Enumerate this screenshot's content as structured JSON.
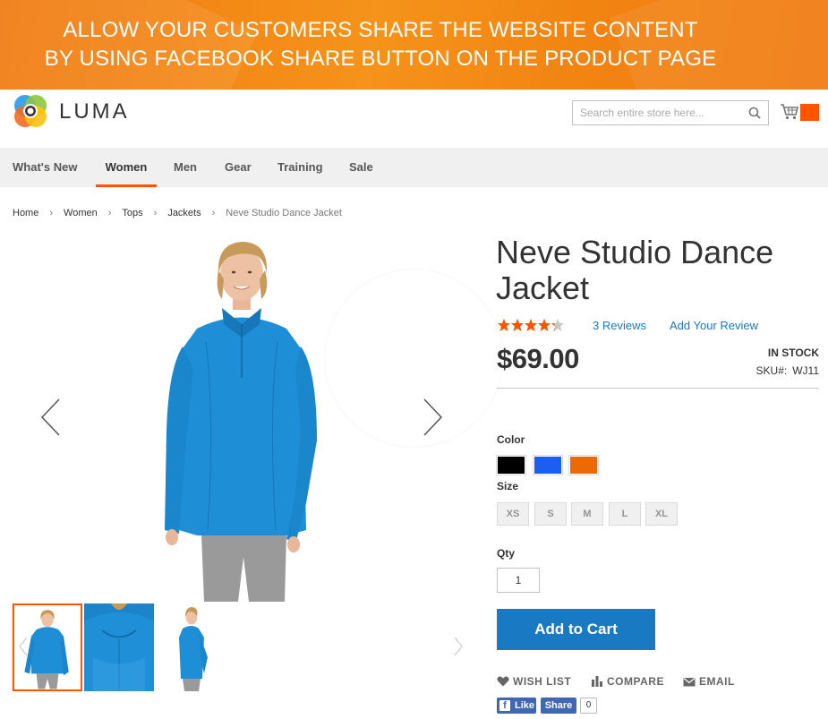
{
  "banner": {
    "line1": "ALLOW YOUR CUSTOMERS SHARE THE WEBSITE CONTENT",
    "line2": "BY USING FACEBOOK SHARE BUTTON ON THE PRODUCT PAGE"
  },
  "header": {
    "logo_text": "LUMA",
    "search_placeholder": "Search entire store here...",
    "search_icon": "search-icon",
    "cart_icon": "cart-icon"
  },
  "nav": {
    "items": [
      {
        "label": "What's New",
        "active": false
      },
      {
        "label": "Women",
        "active": true
      },
      {
        "label": "Men",
        "active": false
      },
      {
        "label": "Gear",
        "active": false
      },
      {
        "label": "Training",
        "active": false
      },
      {
        "label": "Sale",
        "active": false
      }
    ]
  },
  "breadcrumb": {
    "items": [
      "Home",
      "Women",
      "Tops",
      "Jackets"
    ],
    "current": "Neve Studio Dance Jacket"
  },
  "product": {
    "title": "Neve Studio Dance Jacket",
    "rating": 4.3,
    "rating_max": 5,
    "reviews_link": "3 Reviews",
    "add_review_link": "Add Your Review",
    "price": "$69.00",
    "stock": "IN STOCK",
    "sku_label": "SKU#:",
    "sku": "WJ11",
    "color_label": "Color",
    "colors": [
      "#000000",
      "#1a5ff0",
      "#ec6a06"
    ],
    "size_label": "Size",
    "sizes": [
      "XS",
      "S",
      "M",
      "L",
      "XL"
    ],
    "qty_label": "Qty",
    "qty": "1",
    "add_to_cart": "Add to Cart"
  },
  "actions": {
    "wishlist": "WISH LIST",
    "compare": "COMPARE",
    "email": "EMAIL"
  },
  "facebook": {
    "like": "Like",
    "share": "Share",
    "count": "0"
  },
  "colors": {
    "brand_orange": "#ff5501",
    "link_blue": "#1979c3",
    "fb_blue": "#4267b2"
  }
}
